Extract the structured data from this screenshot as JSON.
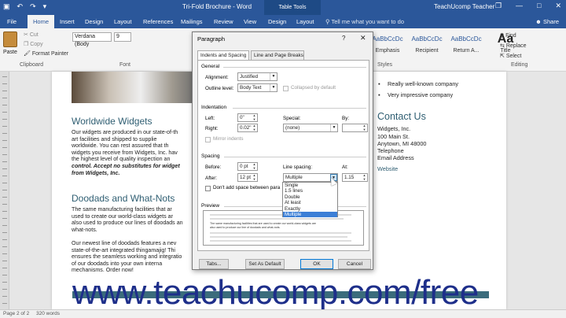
{
  "titlebar": {
    "title": "Tri-Fold Brochure - Word",
    "contextual_tab": "Table Tools",
    "user": "TeachUcomp Teacher",
    "qat": [
      "▣",
      "↶",
      "↷",
      "▾"
    ],
    "controls": [
      "❐",
      "—",
      "□",
      "✕"
    ]
  },
  "tabs": [
    {
      "label": "File"
    },
    {
      "label": "Home"
    },
    {
      "label": "Insert"
    },
    {
      "label": "Design"
    },
    {
      "label": "Layout"
    },
    {
      "label": "References"
    },
    {
      "label": "Mailings"
    },
    {
      "label": "Review"
    },
    {
      "label": "View"
    },
    {
      "label": "Design"
    },
    {
      "label": "Layout"
    }
  ],
  "tellme": "Tell me what you want to do",
  "share": "Share",
  "ribbon": {
    "paste": "Paste",
    "cut": "Cut",
    "copy": "Copy",
    "format_painter": "Format Painter",
    "clipboard": "Clipboard",
    "font_name": "Verdana (Body",
    "font_size": "9",
    "font_group": "Font",
    "styles_group": "Styles",
    "editing_group": "Editing",
    "styles": [
      {
        "sample": "AaBbCcDc",
        "label": "Emphasis"
      },
      {
        "sample": "AaBbCcDc",
        "label": "Recipient"
      },
      {
        "sample": "AaBbCcDc",
        "label": "Return A..."
      },
      {
        "sample": "Aa",
        "label": "Title"
      }
    ],
    "find": "Find",
    "replace": "Replace",
    "select": "Select"
  },
  "document": {
    "heading1": "Worldwide Widgets",
    "para1_lines": [
      "Our widgets are produced in our state-of-th",
      "art facilities and shipped to supplie",
      "worldwide. You can rest assured that th",
      "widgets you receive from Widgets, Inc. hav",
      "the highest level of quality inspection an"
    ],
    "para1_emph1": "control. Accept no substitutes for widget",
    "para1_emph2": "from Widgets, Inc.",
    "heading2": "Doodads and What-Nots",
    "para2_lines": [
      "The same manufacturing facilities that ar",
      "used to create our world-class widgets ar",
      "also used to produce our lines of doodads an",
      "what-nots."
    ],
    "para3_lines": [
      "Our newest line of doodads features a nev",
      "state-of-the-art integrated thingamajig! Thi",
      "ensures the seamless working and integratio",
      "of our doodads into your own interna",
      "mechanisms. Order now!"
    ],
    "bullets": [
      "Really well-known company",
      "Very impressive company"
    ],
    "contact_heading": "Contact Us",
    "contact_lines": [
      "Widgets, Inc.",
      "100 Main St.",
      "Anytown, MI 48000",
      "Telephone",
      "Email Address"
    ],
    "website": "Website"
  },
  "dialog": {
    "title": "Paragraph",
    "help": "?",
    "close": "✕",
    "tabs": [
      "Indents and Spacing",
      "Line and Page Breaks"
    ],
    "general": "General",
    "alignment_label": "Alignment:",
    "alignment_value": "Justified",
    "outline_label": "Outline level:",
    "outline_value": "Body Text",
    "collapsed_label": "Collapsed by default",
    "indentation": "Indentation",
    "left_label": "Left:",
    "left_value": "0\"",
    "right_label": "Right:",
    "right_value": "0.02\"",
    "special_label": "Special:",
    "special_value": "(none)",
    "by_label": "By:",
    "mirror_label": "Mirror indents",
    "spacing": "Spacing",
    "before_label": "Before:",
    "before_value": "0 pt",
    "after_label": "After:",
    "after_value": "12 pt",
    "dont_add_label": "Don't add space between para",
    "line_spacing_label": "Line spacing:",
    "line_spacing_value": "Multiple",
    "at_label": "At:",
    "at_value": "1.15",
    "line_spacing_options": [
      "Single",
      "1.5 lines",
      "Double",
      "At least",
      "Exactly",
      "Multiple"
    ],
    "line_spacing_selected": "Multiple",
    "preview": "Preview",
    "preview_text_line1": "The same manufacturing facilities that are used to create our world-class widgets are",
    "preview_text_line2": "also used to produce our line of doodads and what-nots.",
    "tabs_button": "Tabs...",
    "set_default_button": "Set As Default",
    "ok_button": "OK",
    "cancel_button": "Cancel"
  },
  "statusbar": {
    "page": "Page 2 of 2",
    "words": "320 words"
  },
  "watermark": "www.teachucomp.com/free",
  "colors": {
    "word_blue": "#2b579a",
    "heading_teal": "#2f5e72",
    "watermark_blue": "#1e2f8a",
    "selection_blue": "#3c7fd6"
  }
}
